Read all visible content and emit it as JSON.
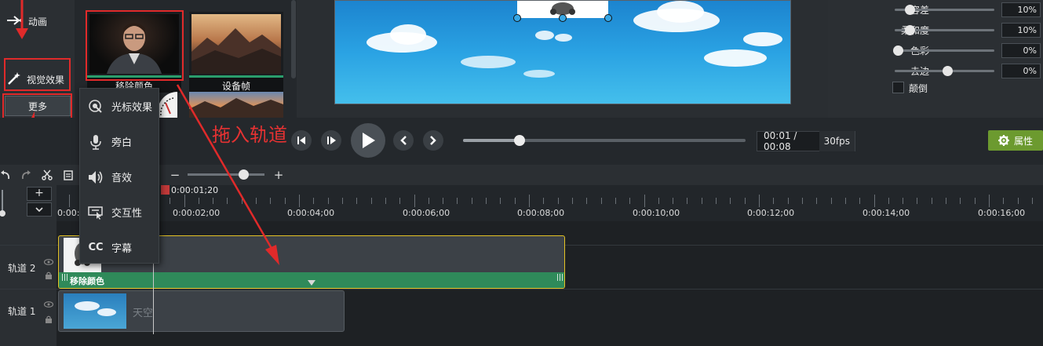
{
  "left_panel": {
    "animation_label": "动画",
    "visual_effects_label": "视觉效果",
    "more_label": "更多"
  },
  "library": {
    "items": [
      {
        "caption": "移除颜色"
      },
      {
        "caption": "设备帧"
      }
    ]
  },
  "popup_menu": {
    "items": [
      {
        "label": "光标效果",
        "icon": "cursor-effect-icon"
      },
      {
        "label": "旁白",
        "icon": "microphone-icon"
      },
      {
        "label": "音效",
        "icon": "speaker-icon"
      },
      {
        "label": "交互性",
        "icon": "interactive-icon"
      },
      {
        "label": "字幕",
        "icon": "cc-icon",
        "glyph": "CC"
      }
    ]
  },
  "annotation": {
    "text": "拖入轨道"
  },
  "properties": {
    "rows": [
      {
        "label": "容差",
        "value": "10%",
        "level": 0.1
      },
      {
        "label": "柔和度",
        "value": "10%",
        "level": 0.1
      },
      {
        "label": "色彩",
        "value": "0%",
        "level": 0.0
      },
      {
        "label": "去边",
        "value": "0%",
        "level": 0.5
      }
    ],
    "invert_label": "颠倒",
    "button_label": "属性"
  },
  "transport": {
    "time": "00:01 / 00:08",
    "fps": "30fps",
    "progress": 0.2
  },
  "timeline": {
    "playhead_time": "0:00:01;20",
    "zoom_minus": "−",
    "zoom_plus": "+",
    "ruler_labels": [
      "0:00:00",
      "0:00:02;00",
      "0:00:04;00",
      "0:00:06;00",
      "0:00:08;00",
      "0:00:10;00",
      "0:00:12;00",
      "0:00:14;00",
      "0:00:16;00"
    ],
    "tracks": [
      {
        "name": "轨道 2",
        "clip_label": "移除颜色"
      },
      {
        "name": "轨道 1",
        "clip_label": "天空"
      }
    ]
  },
  "colors": {
    "accent_green": "#6c9a2f",
    "effect_green": "#2f8a5a",
    "annotation_red": "#e02a2a",
    "clip_selected_border": "#e4c224"
  }
}
